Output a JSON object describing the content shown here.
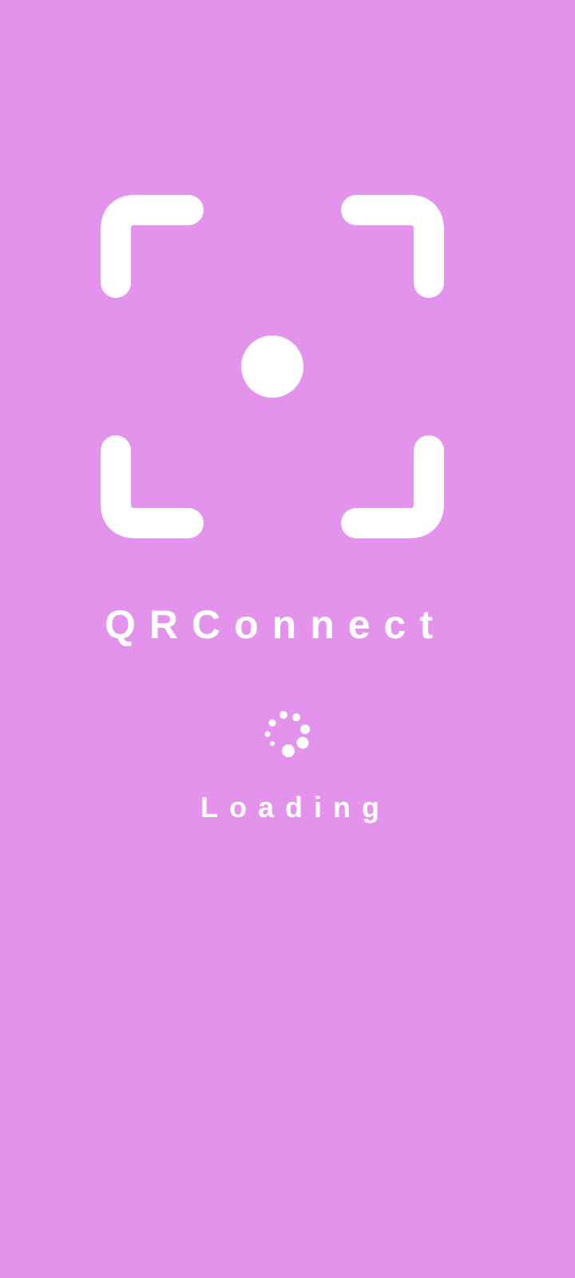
{
  "app": {
    "name": "QRConnect",
    "logo_icon": "qr-scanner-frame-icon"
  },
  "status": {
    "label": "Loading",
    "spinner_icon": "loading-spinner-icon"
  },
  "colors": {
    "background": "#e493ec",
    "foreground": "#ffffff"
  }
}
